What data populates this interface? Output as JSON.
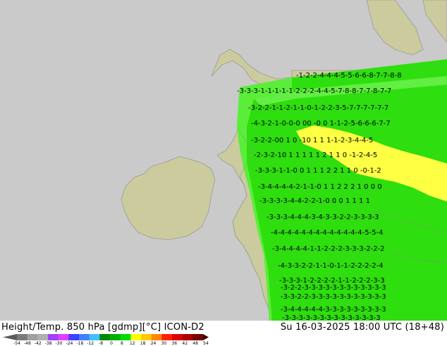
{
  "title": {
    "left": "Height/Temp. 850 hPa [gdmp][°C] ICON-D2",
    "right": "Su 16-03-2025 18:00 UTC (18+48)"
  },
  "colors": {
    "sea": "#cacaca",
    "land": "#cbcb9e",
    "domain_green": "#2ede0e",
    "light_green": "#55ee55",
    "yellow": "#ffff44",
    "border": "#9a9a9a"
  },
  "scale": {
    "ticks": [
      "-54",
      "-48",
      "-42",
      "-38",
      "-30",
      "-24",
      "-18",
      "-12",
      "-8",
      "0",
      "8",
      "12",
      "18",
      "24",
      "30",
      "36",
      "42",
      "48",
      "54"
    ],
    "colors": [
      "#7a7a7a",
      "#a0a0a0",
      "#b0b0b0",
      "#a040ff",
      "#e040ff",
      "#4040ff",
      "#4080ff",
      "#40c0ff",
      "#008800",
      "#00b000",
      "#00dc00",
      "#ffff00",
      "#ffcc00",
      "#ff8800",
      "#ff2200",
      "#dd0000",
      "#aa0000",
      "#770000"
    ]
  },
  "contour_rows": [
    "-1-2-2-4-4-4-5-5-6-6-8-7-7-8-8",
    "-3-3-3-1-1-1-1-1-2-2-2-4-4-5-7-8-8-7-7-8-7-7",
    "-3-2-2-1-1-2-1-1-0-1-2-2-3-5-7-7-7-7-7-7",
    "-4-3-2-1-0-0-0 00 -0 0 1-1-2-5-6-6-6-7-7",
    "-3-2-2-00 1 0 -10 1 1 1-1-2-3-4-4-5",
    "-2-3-2-10 1 1 1 1 1 2 1 1 0 -1-2-4-5",
    "-3-3-3-1-1-0 0 1 1 1 2 2 1 1 0 -0-1-2",
    "-3-4-4-4-4-2-1-1-0 1 1 2 2 2 1 0 0 0",
    "-3-3-3-3-4-4-2-2-1-0 0 0 1 1 1 1",
    "-3-3-3-4-4-4-3-4-3-3-2-2-3-3-3-3",
    "-4-4-4-4-4-4-4-4-4-4-4-4-4-5-5-4",
    "-3-4-4-4-4-1-1-2-2-2-3-3-3-2-2-2",
    "-4-3-3-2-2-1-1-0-1-1-2-2-2-2-4",
    "-3-3-3-1-2-2-2-2-1-1-2-2-2-3-3",
    "-3-2-2-3-3-3-3-3-3-3-3-3-3-3-3",
    "-3-3-2-2-3-3-3-3-3-3-3-3-3-3-3",
    "-3-4-4-4-4-4-3-3-3-3-3-3-3-3-3",
    "-3-3-3-3-3-3-3-3-3-3-3-3-3-3"
  ]
}
